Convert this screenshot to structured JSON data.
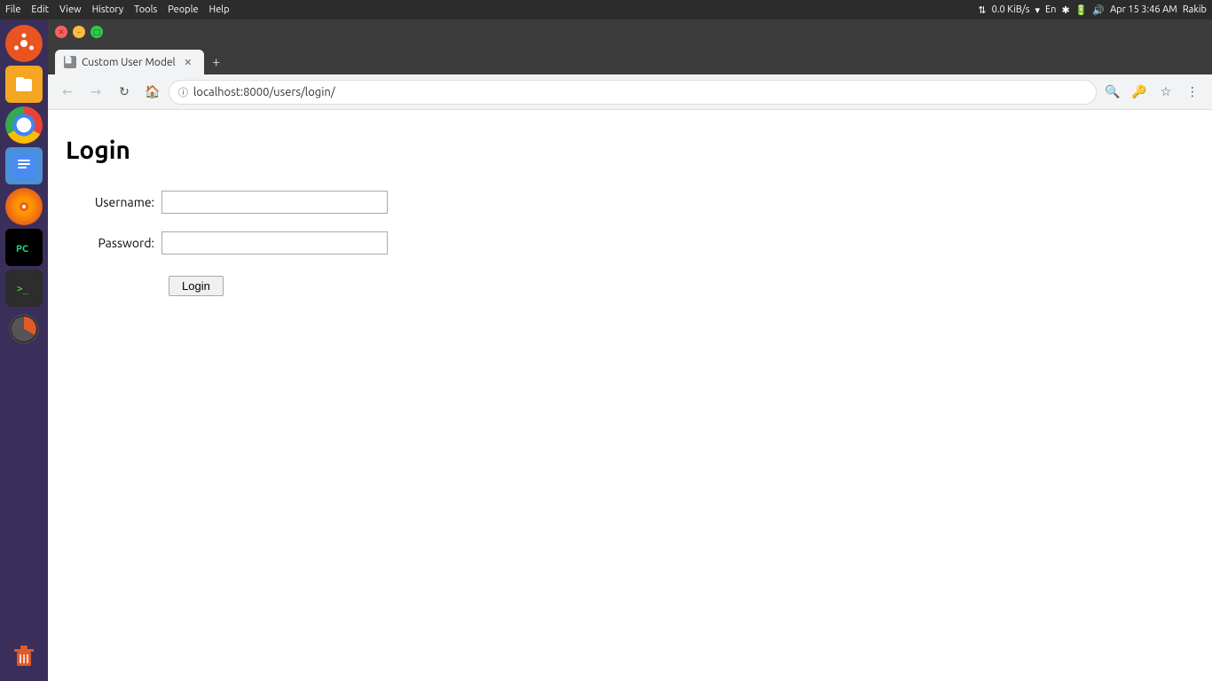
{
  "os": {
    "topbar": {
      "menus": [
        "File",
        "Edit",
        "View",
        "History",
        "Tools",
        "People",
        "Help"
      ],
      "network_speed": "0.0 KiB/s",
      "lang": "En",
      "datetime": "Apr 15  3:46 AM",
      "user": "Rakib",
      "user2": "Rakib"
    }
  },
  "browser": {
    "tab": {
      "title": "Custom User Model",
      "favicon": "📄"
    },
    "menubar": [
      "File",
      "Edit",
      "View",
      "History",
      "Tools",
      "People",
      "Help"
    ],
    "address": "localhost:8000/users/login/",
    "address_protocol": "ⓘ"
  },
  "page": {
    "title": "Login",
    "username_label": "Username:",
    "password_label": "Password:",
    "login_button": "Login"
  },
  "sidebar": {
    "icons": [
      {
        "name": "ubuntu-icon",
        "label": "Ubuntu"
      },
      {
        "name": "files-icon",
        "label": "Files"
      },
      {
        "name": "chrome-icon",
        "label": "Chrome"
      },
      {
        "name": "docs-icon",
        "label": "Docs"
      },
      {
        "name": "firefox-icon",
        "label": "Firefox"
      },
      {
        "name": "pycharm-icon",
        "label": "PyCharm"
      },
      {
        "name": "terminal-icon",
        "label": "Terminal"
      },
      {
        "name": "clock-icon",
        "label": "Clock"
      },
      {
        "name": "trash-icon",
        "label": "Trash"
      }
    ]
  }
}
